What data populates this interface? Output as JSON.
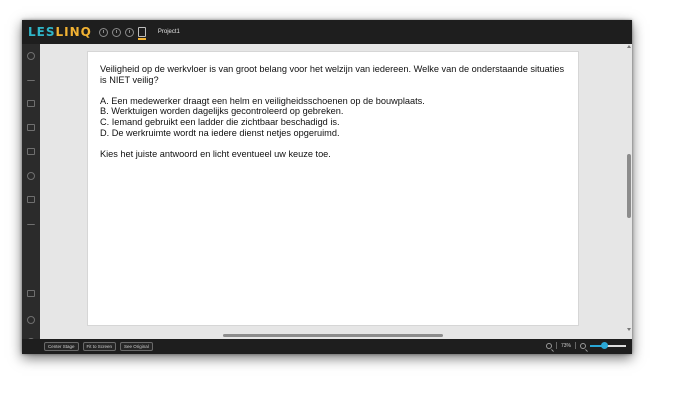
{
  "app": {
    "logo_prefix": "LES",
    "logo_suffix": "LINQ",
    "project_name": "Project1"
  },
  "topbar_icons": [
    "timer-icon",
    "clock-icon",
    "history-icon",
    "document-icon"
  ],
  "sidebar_icons": [
    "share-icon",
    "upload-icon",
    "fullscreen-icon",
    "image-icon",
    "video-icon",
    "shapes-icon",
    "interactive-icon",
    "eraser-icon",
    "grid-icon",
    "settings-icon",
    "layers-icon"
  ],
  "question": {
    "intro": "Veiligheid op de werkvloer is van groot belang voor het welzijn van iedereen. Welke van de onderstaande situaties is NIET veilig?",
    "options": [
      "A. Een medewerker draagt een helm en veiligheidsschoenen op de bouwplaats.",
      "B. Werktuigen worden dagelijks gecontroleerd op gebreken.",
      "C. Iemand gebruikt een ladder die zichtbaar beschadigd is.",
      "D. De werkruimte wordt na iedere dienst netjes opgeruimd."
    ],
    "instruction": "Kies het juiste antwoord en licht eventueel uw keuze toe."
  },
  "bottombar": {
    "center_stage": "Center Stage",
    "fit_to_screen": "Fit to Screen",
    "see_original": "See Original",
    "zoom_value": "73%",
    "zoom_level": 0.73
  },
  "colors": {
    "logo_cyan": "#2fb6c9",
    "logo_yellow": "#f2b233",
    "slider_accent": "#2aa7d6"
  }
}
